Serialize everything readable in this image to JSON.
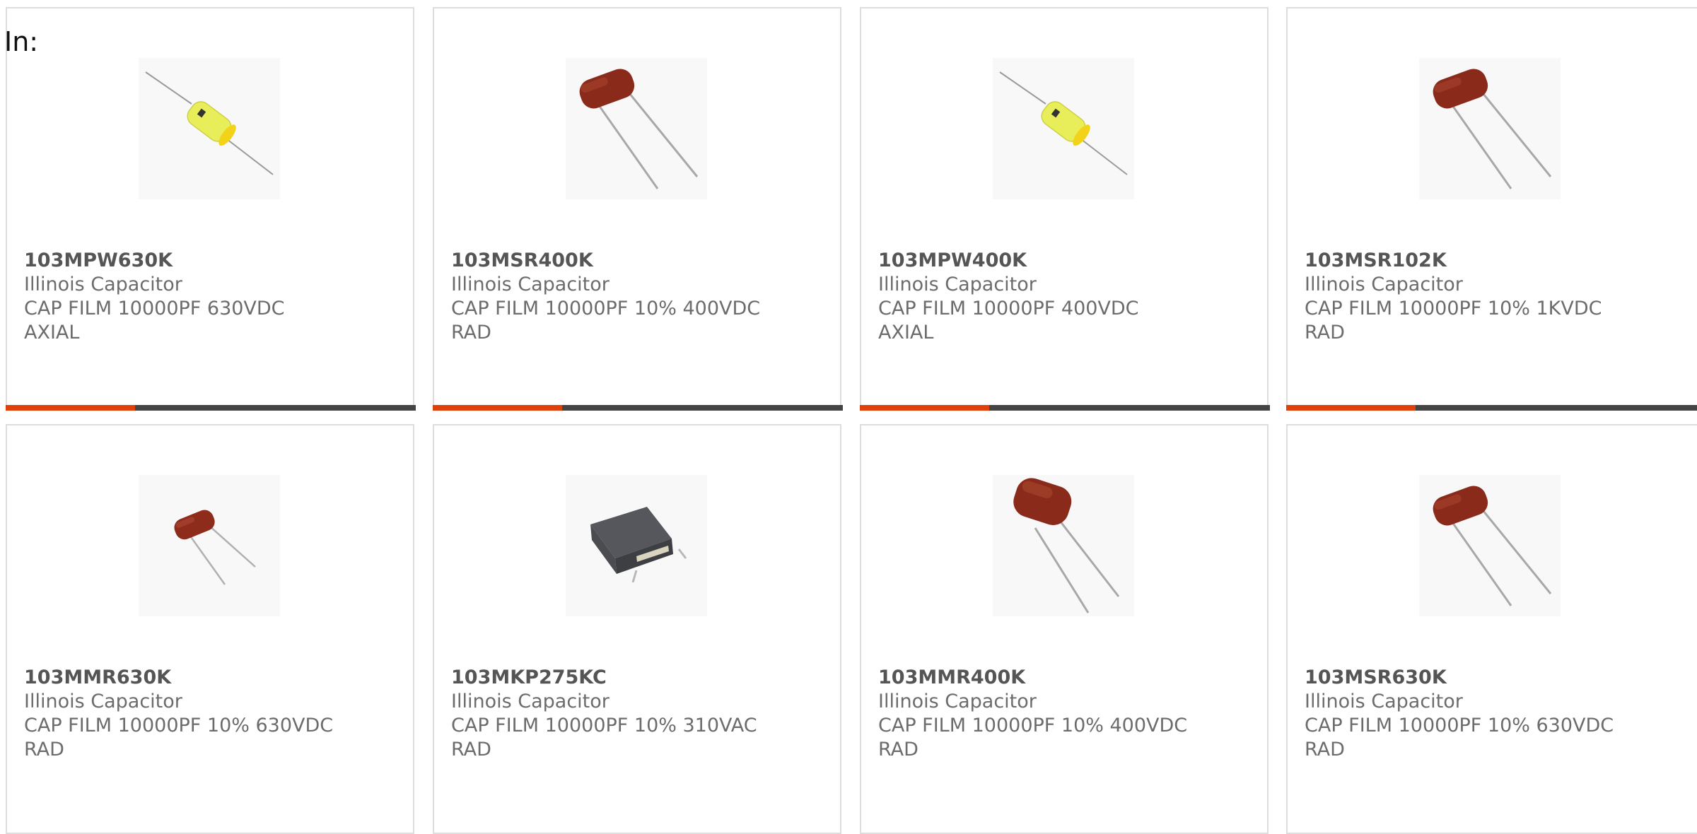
{
  "header": {
    "label": "In:"
  },
  "colors": {
    "accent": "#e0400a",
    "bar_dark": "#444444"
  },
  "products": [
    {
      "part_number": "103MPW630K",
      "manufacturer": "Illinois Capacitor",
      "desc_1": "CAP FILM 10000PF 630VDC",
      "desc_2": "AXIAL",
      "image": "axial-yellow-capacitor"
    },
    {
      "part_number": "103MSR400K",
      "manufacturer": "Illinois Capacitor",
      "desc_1": "CAP FILM 10000PF 10% 400VDC",
      "desc_2": "RAD",
      "image": "radial-brown-capacitor"
    },
    {
      "part_number": "103MPW400K",
      "manufacturer": "Illinois Capacitor",
      "desc_1": "CAP FILM 10000PF 400VDC",
      "desc_2": "AXIAL",
      "image": "axial-yellow-capacitor"
    },
    {
      "part_number": "103MSR102K",
      "manufacturer": "Illinois Capacitor",
      "desc_1": "CAP FILM 10000PF 10% 1KVDC",
      "desc_2": "RAD",
      "image": "radial-brown-capacitor"
    },
    {
      "part_number": "103MMR630K",
      "manufacturer": "Illinois Capacitor",
      "desc_1": "CAP FILM 10000PF 10% 630VDC",
      "desc_2": "RAD",
      "image": "radial-brown-capacitor-small"
    },
    {
      "part_number": "103MKP275KC",
      "manufacturer": "Illinois Capacitor",
      "desc_1": "CAP FILM 10000PF 10% 310VAC",
      "desc_2": "RAD",
      "image": "box-gray-capacitor"
    },
    {
      "part_number": "103MMR400K",
      "manufacturer": "Illinois Capacitor",
      "desc_1": "CAP FILM 10000PF 10% 400VDC",
      "desc_2": "RAD",
      "image": "radial-brown-capacitor-large"
    },
    {
      "part_number": "103MSR630K",
      "manufacturer": "Illinois Capacitor",
      "desc_1": "CAP FILM 10000PF 10% 630VDC",
      "desc_2": "RAD",
      "image": "radial-brown-capacitor"
    }
  ]
}
